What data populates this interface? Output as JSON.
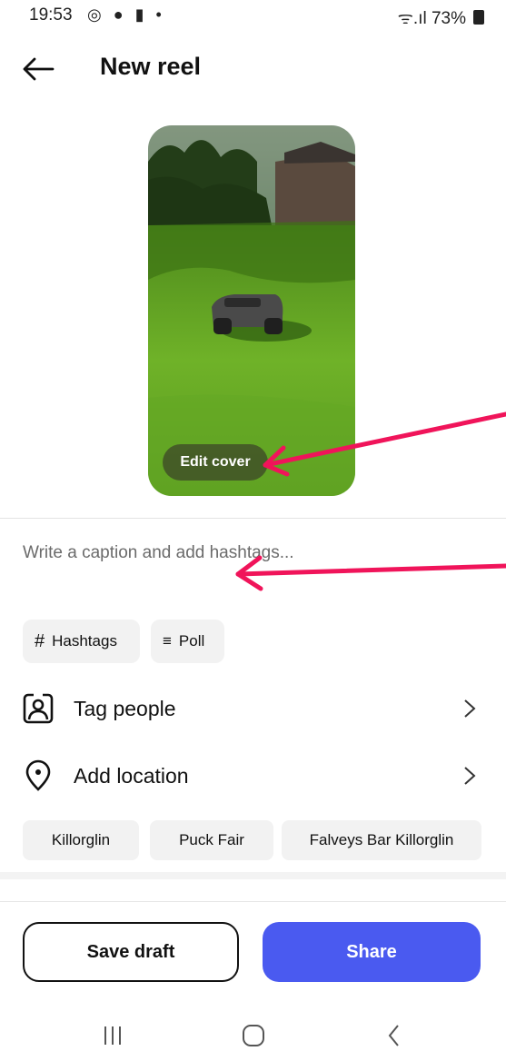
{
  "status_bar": {
    "time": "19:53",
    "left_icons": "◎ ● ▮ •",
    "right_text": "ᯤ.ıl 73%"
  },
  "header": {
    "back_icon": "arrow-left-icon",
    "title": "New reel"
  },
  "cover": {
    "edit_label": "Edit cover"
  },
  "caption": {
    "placeholder": "Write a caption and add hashtags..."
  },
  "quick_chips": [
    {
      "icon": "#",
      "label": "Hashtags"
    },
    {
      "icon": "≡",
      "label": "Poll"
    }
  ],
  "rows": [
    {
      "icon": "tag-people-icon",
      "label": "Tag people"
    },
    {
      "icon": "location-pin-icon",
      "label": "Add location"
    }
  ],
  "location_suggestions": [
    "Killorglin",
    "Puck Fair",
    "Falveys Bar Killorglin"
  ],
  "footer": {
    "save_draft": "Save draft",
    "share": "Share"
  },
  "colors": {
    "share_button": "#4a5af0",
    "annotation_arrow": "#f0145a"
  }
}
